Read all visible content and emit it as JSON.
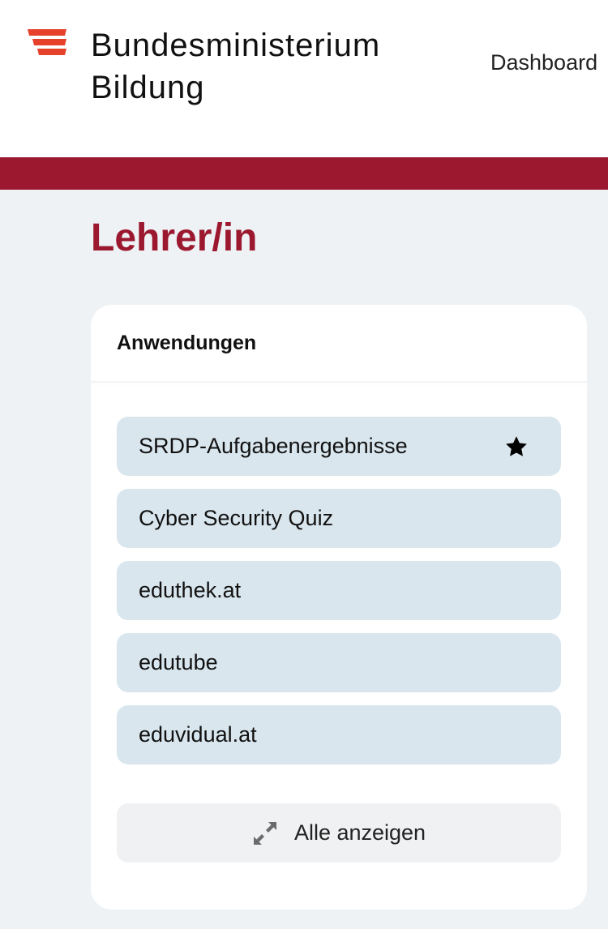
{
  "header": {
    "logo_line1": "Bundesministerium",
    "logo_line2": "Bildung",
    "nav_dashboard": "Dashboard"
  },
  "page": {
    "title": "Lehrer/in"
  },
  "applications": {
    "title": "Anwendungen",
    "items": [
      {
        "label": "SRDP-Aufgabenergebnisse",
        "favorite": true
      },
      {
        "label": "Cyber Security Quiz",
        "favorite": false
      },
      {
        "label": "eduthek.at",
        "favorite": false
      },
      {
        "label": "edutube",
        "favorite": false
      },
      {
        "label": "eduvidual.at",
        "favorite": false
      }
    ],
    "show_all_label": "Alle anzeigen",
    "icons": {
      "favorite": "star-icon",
      "show_all": "expand-icon"
    }
  },
  "colors": {
    "brand_red": "#9b182f",
    "logo_red": "#e6412a",
    "app_item_bg": "#d9e6ee",
    "page_bg": "#eef2f5"
  }
}
